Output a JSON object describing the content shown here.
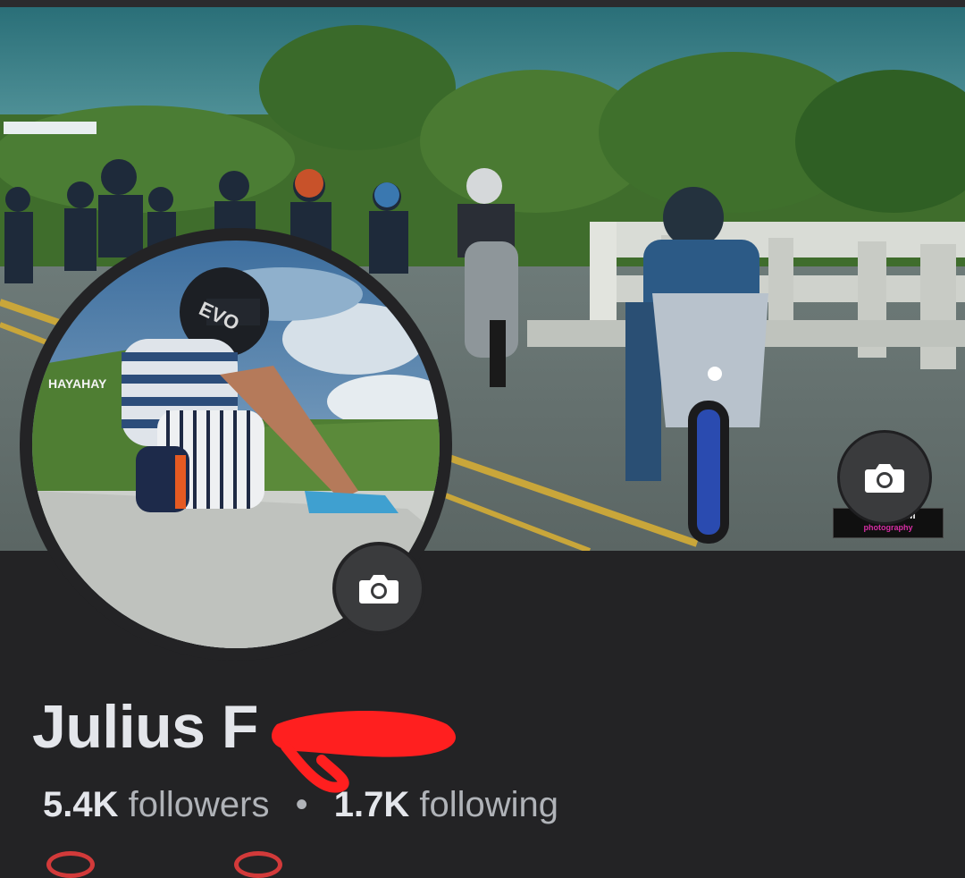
{
  "profile": {
    "name_visible": "Julius F",
    "followers_count": "5.4K",
    "followers_label": "followers",
    "separator": "•",
    "following_count": "1.7K",
    "following_label": "following"
  },
  "cover": {
    "camera_icon": "camera-icon",
    "watermark_line1": "VT ⋯ HAM",
    "watermark_line2": "photography"
  },
  "avatar": {
    "sign_text": "HAYAHAY",
    "helmet_text": "EVO",
    "camera_icon": "camera-icon"
  },
  "colors": {
    "background": "#232325",
    "name_text": "#e4e6eb",
    "secondary_text": "#b0b3b8",
    "camera_button": "#3a3b3d",
    "redaction": "#ff1f1f"
  }
}
